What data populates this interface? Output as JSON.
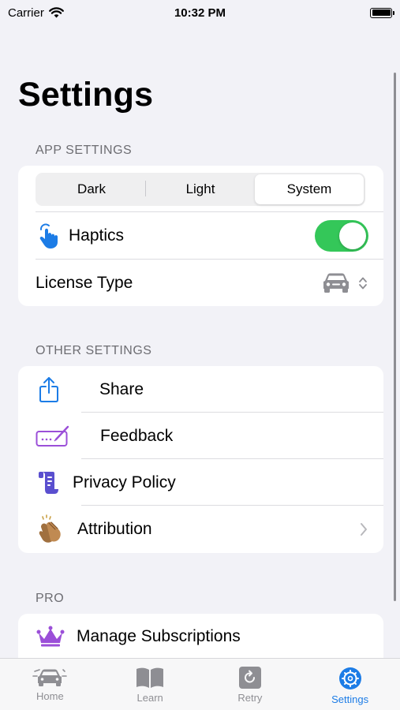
{
  "status_bar": {
    "carrier": "Carrier",
    "time": "10:32 PM"
  },
  "page": {
    "title": "Settings"
  },
  "app_settings": {
    "header": "APP SETTINGS",
    "appearance": {
      "options": [
        "Dark",
        "Light",
        "System"
      ],
      "selected": "System"
    },
    "haptics": {
      "label": "Haptics",
      "icon": "hand-tap-icon",
      "enabled": true
    },
    "license_type": {
      "label": "License Type",
      "icon": "car-icon"
    }
  },
  "other_settings": {
    "header": "OTHER SETTINGS",
    "items": [
      {
        "label": "Share",
        "icon": "share-icon"
      },
      {
        "label": "Feedback",
        "icon": "feedback-icon"
      },
      {
        "label": "Privacy Policy",
        "icon": "scroll-icon"
      },
      {
        "label": "Attribution",
        "icon": "clapping-hands-icon"
      }
    ]
  },
  "pro": {
    "header": "PRO",
    "items": [
      {
        "label": "Manage Subscriptions",
        "icon": "crown-icon"
      }
    ]
  },
  "tab_bar": {
    "tabs": [
      {
        "label": "Home",
        "icon": "car-front-icon"
      },
      {
        "label": "Learn",
        "icon": "book-icon"
      },
      {
        "label": "Retry",
        "icon": "retry-icon"
      },
      {
        "label": "Settings",
        "icon": "gear-icon"
      }
    ],
    "active": "Settings"
  },
  "colors": {
    "accent": "#1c7ce6",
    "toggle_on": "#34c759",
    "background": "#f2f2f7",
    "feedback": "#9b4fd8",
    "privacy": "#5a4fcf",
    "crown": "#9b4fd8"
  }
}
